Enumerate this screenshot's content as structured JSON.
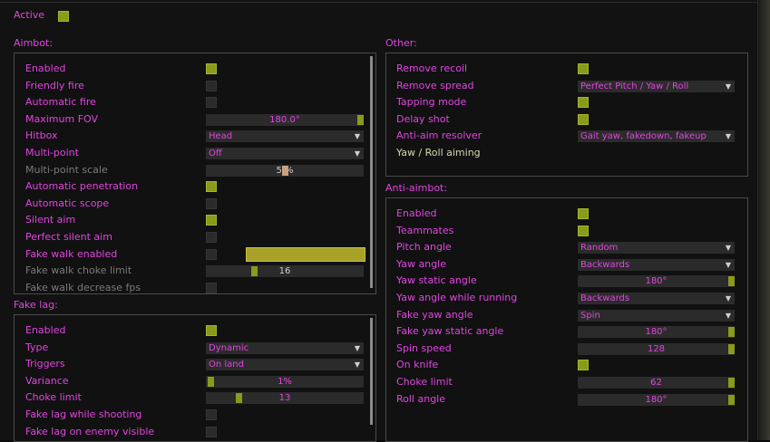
{
  "active_label": "Active",
  "aimbot": {
    "title": "Aimbot:",
    "rows": [
      {
        "label": "Enabled",
        "state": "on"
      },
      {
        "label": "Friendly fire",
        "state": "off"
      },
      {
        "label": "Automatic fire",
        "state": "off"
      },
      {
        "label": "Maximum FOV",
        "slider": "180.0°",
        "fraction": 1.0
      },
      {
        "label": "Hitbox",
        "dropdown": "Head"
      },
      {
        "label": "Multi-point",
        "dropdown": "Off"
      },
      {
        "label": "Multi-point scale",
        "slider": "5 %",
        "fraction": 0.5,
        "disabled": true
      },
      {
        "label": "Automatic penetration",
        "state": "on"
      },
      {
        "label": "Automatic scope",
        "state": "off"
      },
      {
        "label": "Silent aim",
        "state": "on"
      },
      {
        "label": "Perfect silent aim",
        "state": "off"
      },
      {
        "label": "Fake walk enabled",
        "state": "off",
        "highlight": true
      },
      {
        "label": "Fake walk choke limit",
        "slider": "16",
        "fraction": 0.3,
        "disabled": true
      },
      {
        "label": "Fake walk decrease fps",
        "state": "off",
        "disabled": true
      }
    ]
  },
  "fakelag": {
    "title": "Fake lag:",
    "rows": [
      {
        "label": "Enabled",
        "state": "on"
      },
      {
        "label": "Type",
        "dropdown": "Dynamic"
      },
      {
        "label": "Triggers",
        "dropdown": "On land"
      },
      {
        "label": "Variance",
        "slider": "1%",
        "fraction": 0.01
      },
      {
        "label": "Choke limit",
        "slider": "13",
        "fraction": 0.2
      },
      {
        "label": "Fake lag while shooting",
        "state": "off"
      },
      {
        "label": "Fake lag on enemy visible",
        "state": "off"
      }
    ]
  },
  "other": {
    "title": "Other:",
    "rows": [
      {
        "label": "Remove recoil",
        "state": "on"
      },
      {
        "label": "Remove spread",
        "dropdown": "Perfect Pitch / Yaw / Roll"
      },
      {
        "label": "Tapping mode",
        "state": "on"
      },
      {
        "label": "Delay shot",
        "state": "on"
      },
      {
        "label": "Anti-aim resolver",
        "dropdown": "Gait yaw, fakedown, fakeup"
      },
      {
        "label": "Yaw / Roll aiming",
        "plain": true
      }
    ]
  },
  "antiaim": {
    "title": "Anti-aimbot:",
    "rows": [
      {
        "label": "Enabled",
        "state": "on"
      },
      {
        "label": "Teammates",
        "state": "on"
      },
      {
        "label": "Pitch angle",
        "dropdown": "Random"
      },
      {
        "label": "Yaw angle",
        "dropdown": "Backwards"
      },
      {
        "label": "Yaw static angle",
        "slider": "180°",
        "fraction": 1.0
      },
      {
        "label": "Yaw angle while running",
        "dropdown": "Backwards"
      },
      {
        "label": "Fake yaw angle",
        "dropdown": "Spin"
      },
      {
        "label": "Fake yaw static angle",
        "slider": "180°",
        "fraction": 1.0
      },
      {
        "label": "Spin speed",
        "slider": "128",
        "fraction": 1.0
      },
      {
        "label": "On knife",
        "state": "on"
      },
      {
        "label": "Choke limit",
        "slider": "62",
        "fraction": 1.0
      },
      {
        "label": "Roll angle",
        "slider": "180°",
        "fraction": 1.0
      }
    ]
  },
  "colors": {
    "accent": "#e046e0",
    "check_on": "#8a9a1a",
    "control_bg": "#2b2b2b"
  }
}
